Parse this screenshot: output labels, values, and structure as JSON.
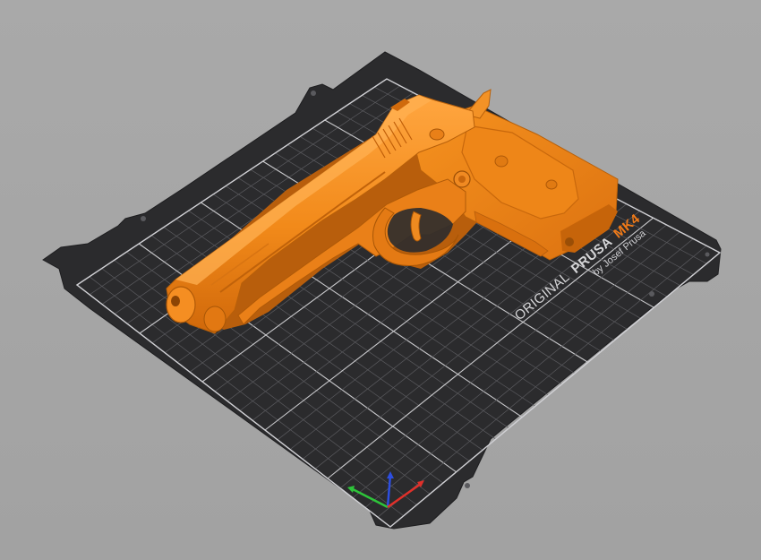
{
  "bed": {
    "brand_prefix": "ORIGINAL",
    "brand_name": "PRUSA",
    "model": "MK4",
    "byline": "by Josef Prusa"
  },
  "colors": {
    "background": "#a6a6a6",
    "bed_plate": "#2b2b2d",
    "grid_minor": "#5a5a5e",
    "grid_major": "#c9c9cc",
    "model_orange": "#f28a1a",
    "model_shadow": "#c9640a",
    "model_highlight": "#ffae4a",
    "brand_accent": "#f07a18",
    "axis_x": "#e0302a",
    "axis_y": "#2ec43a",
    "axis_z": "#2d4ee0"
  },
  "icons": {
    "axes": "xyz-axes-icon",
    "object": "pistol-model"
  }
}
